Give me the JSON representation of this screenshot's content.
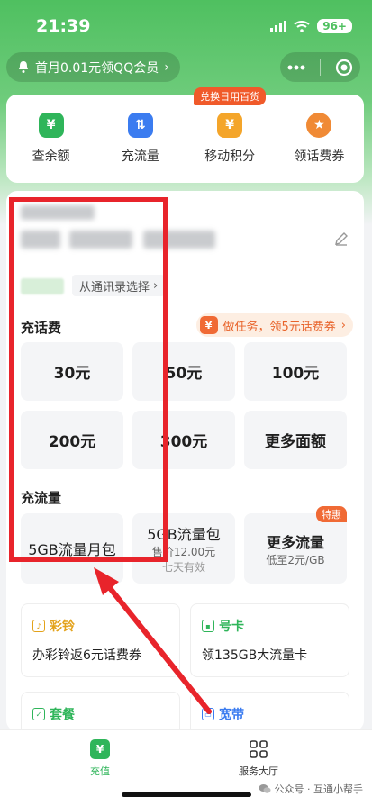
{
  "status_bar": {
    "time": "21:39",
    "battery": "96+"
  },
  "header": {
    "promo_text": "首月0.01元领QQ会员",
    "promo_arrow": "›"
  },
  "quick_actions": [
    {
      "label": "查余额",
      "icon": "yen-icon",
      "color": "#2fb55a",
      "glyph": "¥"
    },
    {
      "label": "充流量",
      "icon": "data-transfer-icon",
      "color": "#3b7cf0",
      "glyph": "⇅"
    },
    {
      "label": "移动积分",
      "icon": "points-icon",
      "color": "#f4a52a",
      "glyph": "¥",
      "badge": "兑换日用百货"
    },
    {
      "label": "领话费券",
      "icon": "coupon-icon",
      "color": "#f08a35",
      "glyph": "★"
    }
  ],
  "recharge": {
    "contact_button": "从通讯录选择",
    "call_section": "充话费",
    "task_banner": "做任务，领5元话费券",
    "call_amounts": [
      "30元",
      "50元",
      "100元",
      "200元",
      "300元",
      "更多面额"
    ],
    "data_section": "充流量",
    "data_options": [
      {
        "title": "5GB流量月包",
        "sub": ""
      },
      {
        "title": "5GB流量包",
        "sub": "售价12.00元",
        "sub2": "七天有效"
      },
      {
        "title": "更多流量",
        "sub": "低至2元/GB",
        "badge": "特惠"
      }
    ]
  },
  "promos": [
    {
      "title": "彩铃",
      "body": "办彩铃返6元话费券",
      "color": "#e3a21a",
      "icon": "ringtone-icon"
    },
    {
      "title": "号卡",
      "body": "领135GB大流量卡",
      "color": "#2fb55a",
      "icon": "sim-card-icon"
    },
    {
      "title": "套餐",
      "color": "#2fb55a",
      "icon": "package-icon"
    },
    {
      "title": "宽带",
      "color": "#3b7cf0",
      "icon": "broadband-icon"
    }
  ],
  "tabbar": {
    "tabs": [
      "充值",
      "服务大厅"
    ],
    "active_color": "#2fb55a"
  },
  "watermark": "公众号 · 互通小帮手",
  "colors": {
    "brand_green": "#4fc060",
    "annotation_red": "#e8242b",
    "accent_orange": "#f06a35"
  }
}
